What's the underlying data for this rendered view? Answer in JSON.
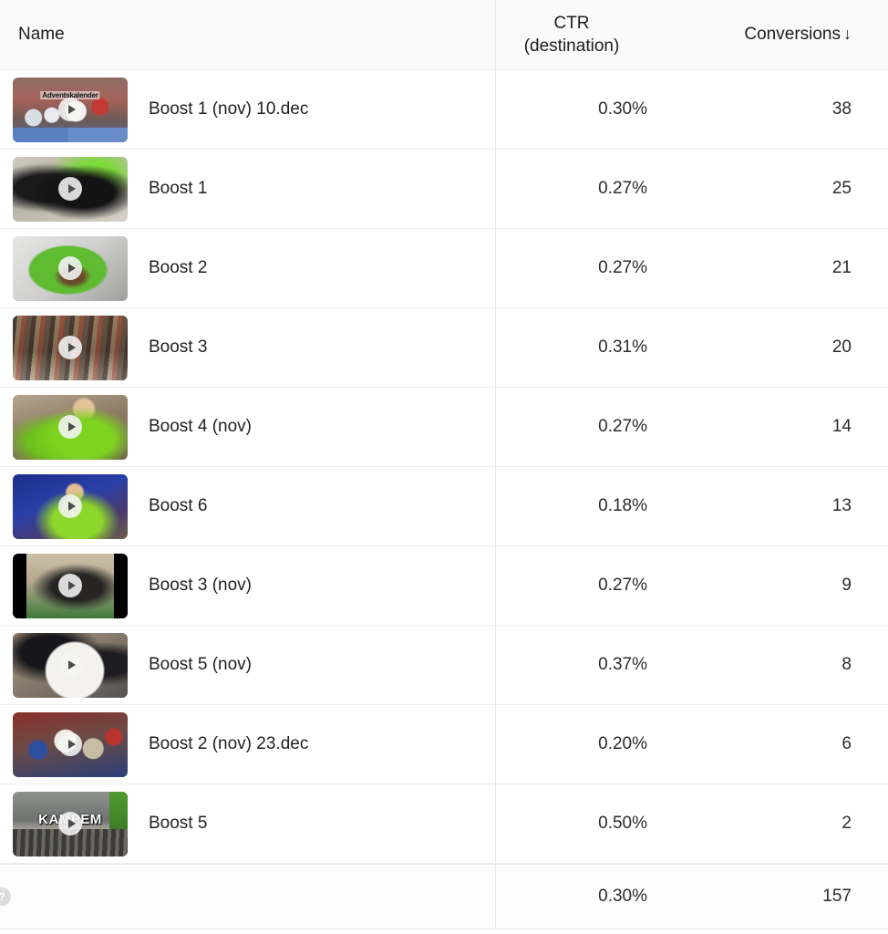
{
  "table": {
    "columns": {
      "name": "Name",
      "ctr_line1": "CTR",
      "ctr_line2": "(destination)",
      "conversions": "Conversions",
      "sort_arrow": "↓"
    },
    "rows": [
      {
        "name": "Boost 1 (nov) 10.dec",
        "ctr": "0.30%",
        "conversions": "38",
        "thumb_overlay": "Adventskalender",
        "thumb_art": "art-xmas",
        "overlay_style": "boxed"
      },
      {
        "name": "Boost 1",
        "ctr": "0.27%",
        "conversions": "25",
        "thumb_overlay": "",
        "thumb_art": "art-dog-black",
        "overlay_style": ""
      },
      {
        "name": "Boost 2",
        "ctr": "0.27%",
        "conversions": "21",
        "thumb_overlay": "",
        "thumb_art": "art-green-mat",
        "overlay_style": ""
      },
      {
        "name": "Boost 3",
        "ctr": "0.31%",
        "conversions": "20",
        "thumb_overlay": "",
        "thumb_art": "art-store-shelf",
        "overlay_style": ""
      },
      {
        "name": "Boost 4 (nov)",
        "ctr": "0.27%",
        "conversions": "14",
        "thumb_overlay": "",
        "thumb_art": "art-green-shirt",
        "overlay_style": ""
      },
      {
        "name": "Boost 6",
        "ctr": "0.18%",
        "conversions": "13",
        "thumb_overlay": "",
        "thumb_art": "art-blue-stage",
        "overlay_style": ""
      },
      {
        "name": "Boost 3 (nov)",
        "ctr": "0.27%",
        "conversions": "9",
        "thumb_overlay": "",
        "thumb_art": "art-dog-letterbox",
        "overlay_style": ""
      },
      {
        "name": "Boost 5 (nov)",
        "ctr": "0.37%",
        "conversions": "8",
        "thumb_overlay": "",
        "thumb_art": "art-dog-white",
        "overlay_style": ""
      },
      {
        "name": "Boost 2 (nov) 23.dec",
        "ctr": "0.20%",
        "conversions": "6",
        "thumb_overlay": "",
        "thumb_art": "art-plush",
        "overlay_style": ""
      },
      {
        "name": "Boost 5",
        "ctr": "0.50%",
        "conversions": "2",
        "thumb_overlay": "KAMPEM",
        "thumb_art": "art-asphalt",
        "overlay_style": "bigcaps"
      }
    ],
    "totals": {
      "help_icon": "?",
      "name": "",
      "ctr": "0.30%",
      "conversions": "157"
    }
  },
  "colors": {
    "header_bg": "#fafafa",
    "row_bg": "#ffffff",
    "totals_bg": "#fcfcfc",
    "divider": "#ededed",
    "text": "#1c1c1c"
  }
}
